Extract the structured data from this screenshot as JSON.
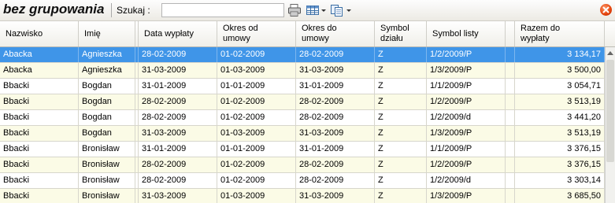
{
  "toolbar": {
    "title": "bez grupowania",
    "search_label": "Szukaj   :",
    "search_value": "",
    "print_icon": "printer-icon",
    "grid_icon": "table-icon",
    "copy_icon": "copy-icon",
    "close_icon": "close-icon"
  },
  "columns": [
    {
      "key": "nazwisko",
      "label": "Nazwisko"
    },
    {
      "key": "imie",
      "label": "Imię"
    },
    {
      "key": "data_wyplaty",
      "label": "Data wypłaty"
    },
    {
      "key": "okres_od",
      "label": "Okres od\numowy"
    },
    {
      "key": "okres_do",
      "label": "Okres do\numowy"
    },
    {
      "key": "symbol_dzialu",
      "label": "Symbol\ndziału"
    },
    {
      "key": "symbol_listy",
      "label": "Symbol listy"
    },
    {
      "key": "razem",
      "label": "Razem do\nwypłaty"
    }
  ],
  "rows": [
    {
      "nazwisko": "Abacka",
      "imie": "Agnieszka",
      "data_wyplaty": "28-02-2009",
      "okres_od": "01-02-2009",
      "okres_do": "28-02-2009",
      "symbol_dzialu": "Z",
      "symbol_listy": "1/2/2009/P",
      "razem": "3 134,17",
      "selected": true
    },
    {
      "nazwisko": "Abacka",
      "imie": "Agnieszka",
      "data_wyplaty": "31-03-2009",
      "okres_od": "01-03-2009",
      "okres_do": "31-03-2009",
      "symbol_dzialu": "Z",
      "symbol_listy": "1/3/2009/P",
      "razem": "3 500,00"
    },
    {
      "nazwisko": "Bbacki",
      "imie": "Bogdan",
      "data_wyplaty": "31-01-2009",
      "okres_od": "01-01-2009",
      "okres_do": "31-01-2009",
      "symbol_dzialu": "Z",
      "symbol_listy": "1/1/2009/P",
      "razem": "3 054,71"
    },
    {
      "nazwisko": "Bbacki",
      "imie": "Bogdan",
      "data_wyplaty": "28-02-2009",
      "okres_od": "01-02-2009",
      "okres_do": "28-02-2009",
      "symbol_dzialu": "Z",
      "symbol_listy": "1/2/2009/P",
      "razem": "3 513,19"
    },
    {
      "nazwisko": "Bbacki",
      "imie": "Bogdan",
      "data_wyplaty": "28-02-2009",
      "okres_od": "01-02-2009",
      "okres_do": "28-02-2009",
      "symbol_dzialu": "Z",
      "symbol_listy": "1/2/2009/d",
      "razem": "3 441,20"
    },
    {
      "nazwisko": "Bbacki",
      "imie": "Bogdan",
      "data_wyplaty": "31-03-2009",
      "okres_od": "01-03-2009",
      "okres_do": "31-03-2009",
      "symbol_dzialu": "Z",
      "symbol_listy": "1/3/2009/P",
      "razem": "3 513,19"
    },
    {
      "nazwisko": "Bbacki",
      "imie": "Bronisław",
      "data_wyplaty": "31-01-2009",
      "okres_od": "01-01-2009",
      "okres_do": "31-01-2009",
      "symbol_dzialu": "Z",
      "symbol_listy": "1/1/2009/P",
      "razem": "3 376,15"
    },
    {
      "nazwisko": "Bbacki",
      "imie": "Bronisław",
      "data_wyplaty": "28-02-2009",
      "okres_od": "01-02-2009",
      "okres_do": "28-02-2009",
      "symbol_dzialu": "Z",
      "symbol_listy": "1/2/2009/P",
      "razem": "3 376,15"
    },
    {
      "nazwisko": "Bbacki",
      "imie": "Bronisław",
      "data_wyplaty": "28-02-2009",
      "okres_od": "01-02-2009",
      "okres_do": "28-02-2009",
      "symbol_dzialu": "Z",
      "symbol_listy": "1/2/2009/d",
      "razem": "3 303,14"
    },
    {
      "nazwisko": "Bbacki",
      "imie": "Bronisław",
      "data_wyplaty": "31-03-2009",
      "okres_od": "01-03-2009",
      "okres_do": "31-03-2009",
      "symbol_dzialu": "Z",
      "symbol_listy": "1/3/2009/P",
      "razem": "3 685,50"
    }
  ],
  "colors": {
    "selected_row": "#3f95e8",
    "alt_row": "#fbfbe6",
    "close_button": "#e3420b"
  }
}
